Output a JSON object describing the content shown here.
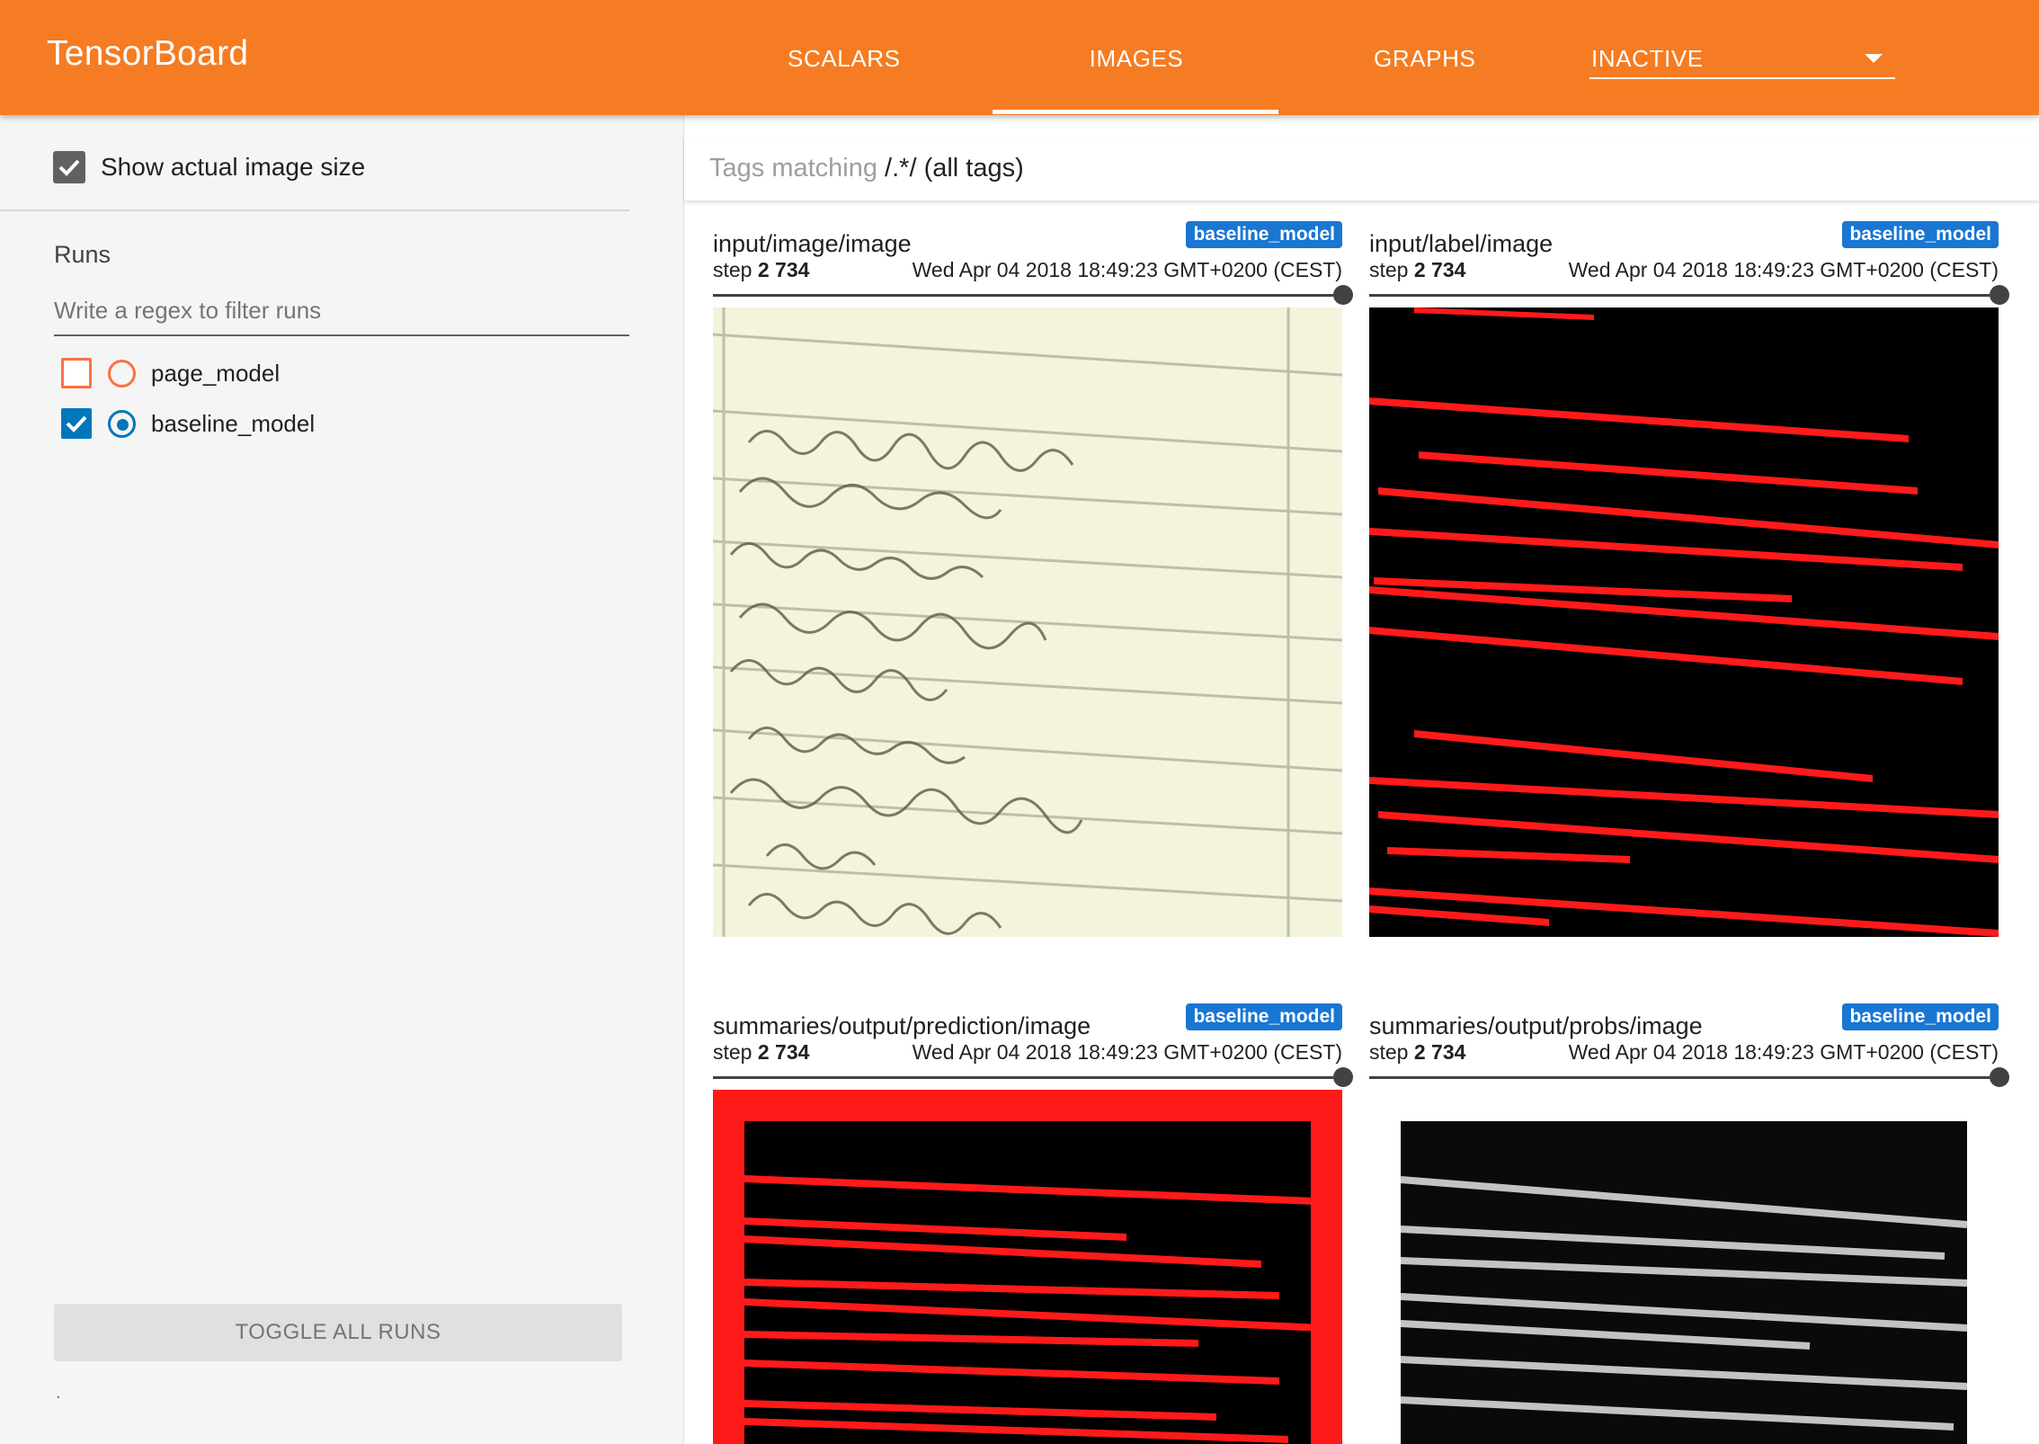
{
  "header": {
    "brand": "TensorBoard",
    "tabs": [
      {
        "label": "SCALARS"
      },
      {
        "label": "IMAGES",
        "active": true
      },
      {
        "label": "GRAPHS"
      }
    ],
    "inactive_select": "INACTIVE"
  },
  "sidebar": {
    "show_actual_size_label": "Show actual image size",
    "show_actual_size_checked": true,
    "runs_title": "Runs",
    "filter_placeholder": "Write a regex to filter runs",
    "runs": [
      {
        "name": "page_model",
        "checked": false,
        "selected": false,
        "color": "#ff7043"
      },
      {
        "name": "baseline_model",
        "checked": true,
        "selected": true,
        "color": "#0077bb"
      }
    ],
    "toggle_all_label": "TOGGLE ALL RUNS",
    "footer_mark": "."
  },
  "main": {
    "tags_filter": {
      "prefix": "Tags matching ",
      "regex": "/.*/",
      "suffix": " (all tags)"
    },
    "cards": [
      {
        "tag": "input/image/image",
        "run": "baseline_model",
        "step_label": "step ",
        "step": "2 734",
        "wall_time": "Wed Apr 04 2018 18:49:23 GMT+0200 (CEST)",
        "image": "handwritten-page"
      },
      {
        "tag": "input/label/image",
        "run": "baseline_model",
        "step_label": "step ",
        "step": "2 734",
        "wall_time": "Wed Apr 04 2018 18:49:23 GMT+0200 (CEST)",
        "image": "red-baseline-label"
      },
      {
        "tag": "summaries/output/prediction/image",
        "run": "baseline_model",
        "step_label": "step ",
        "step": "2 734",
        "wall_time": "Wed Apr 04 2018 18:49:23 GMT+0200 (CEST)",
        "image": "red-baseline-prediction"
      },
      {
        "tag": "summaries/output/probs/image",
        "run": "baseline_model",
        "step_label": "step ",
        "step": "2 734",
        "wall_time": "Wed Apr 04 2018 18:49:23 GMT+0200 (CEST)",
        "image": "grayscale-probability-map"
      }
    ]
  },
  "colors": {
    "header": "#f57c22",
    "badge": "#1976d2",
    "label_red": "#ff1a1a"
  }
}
